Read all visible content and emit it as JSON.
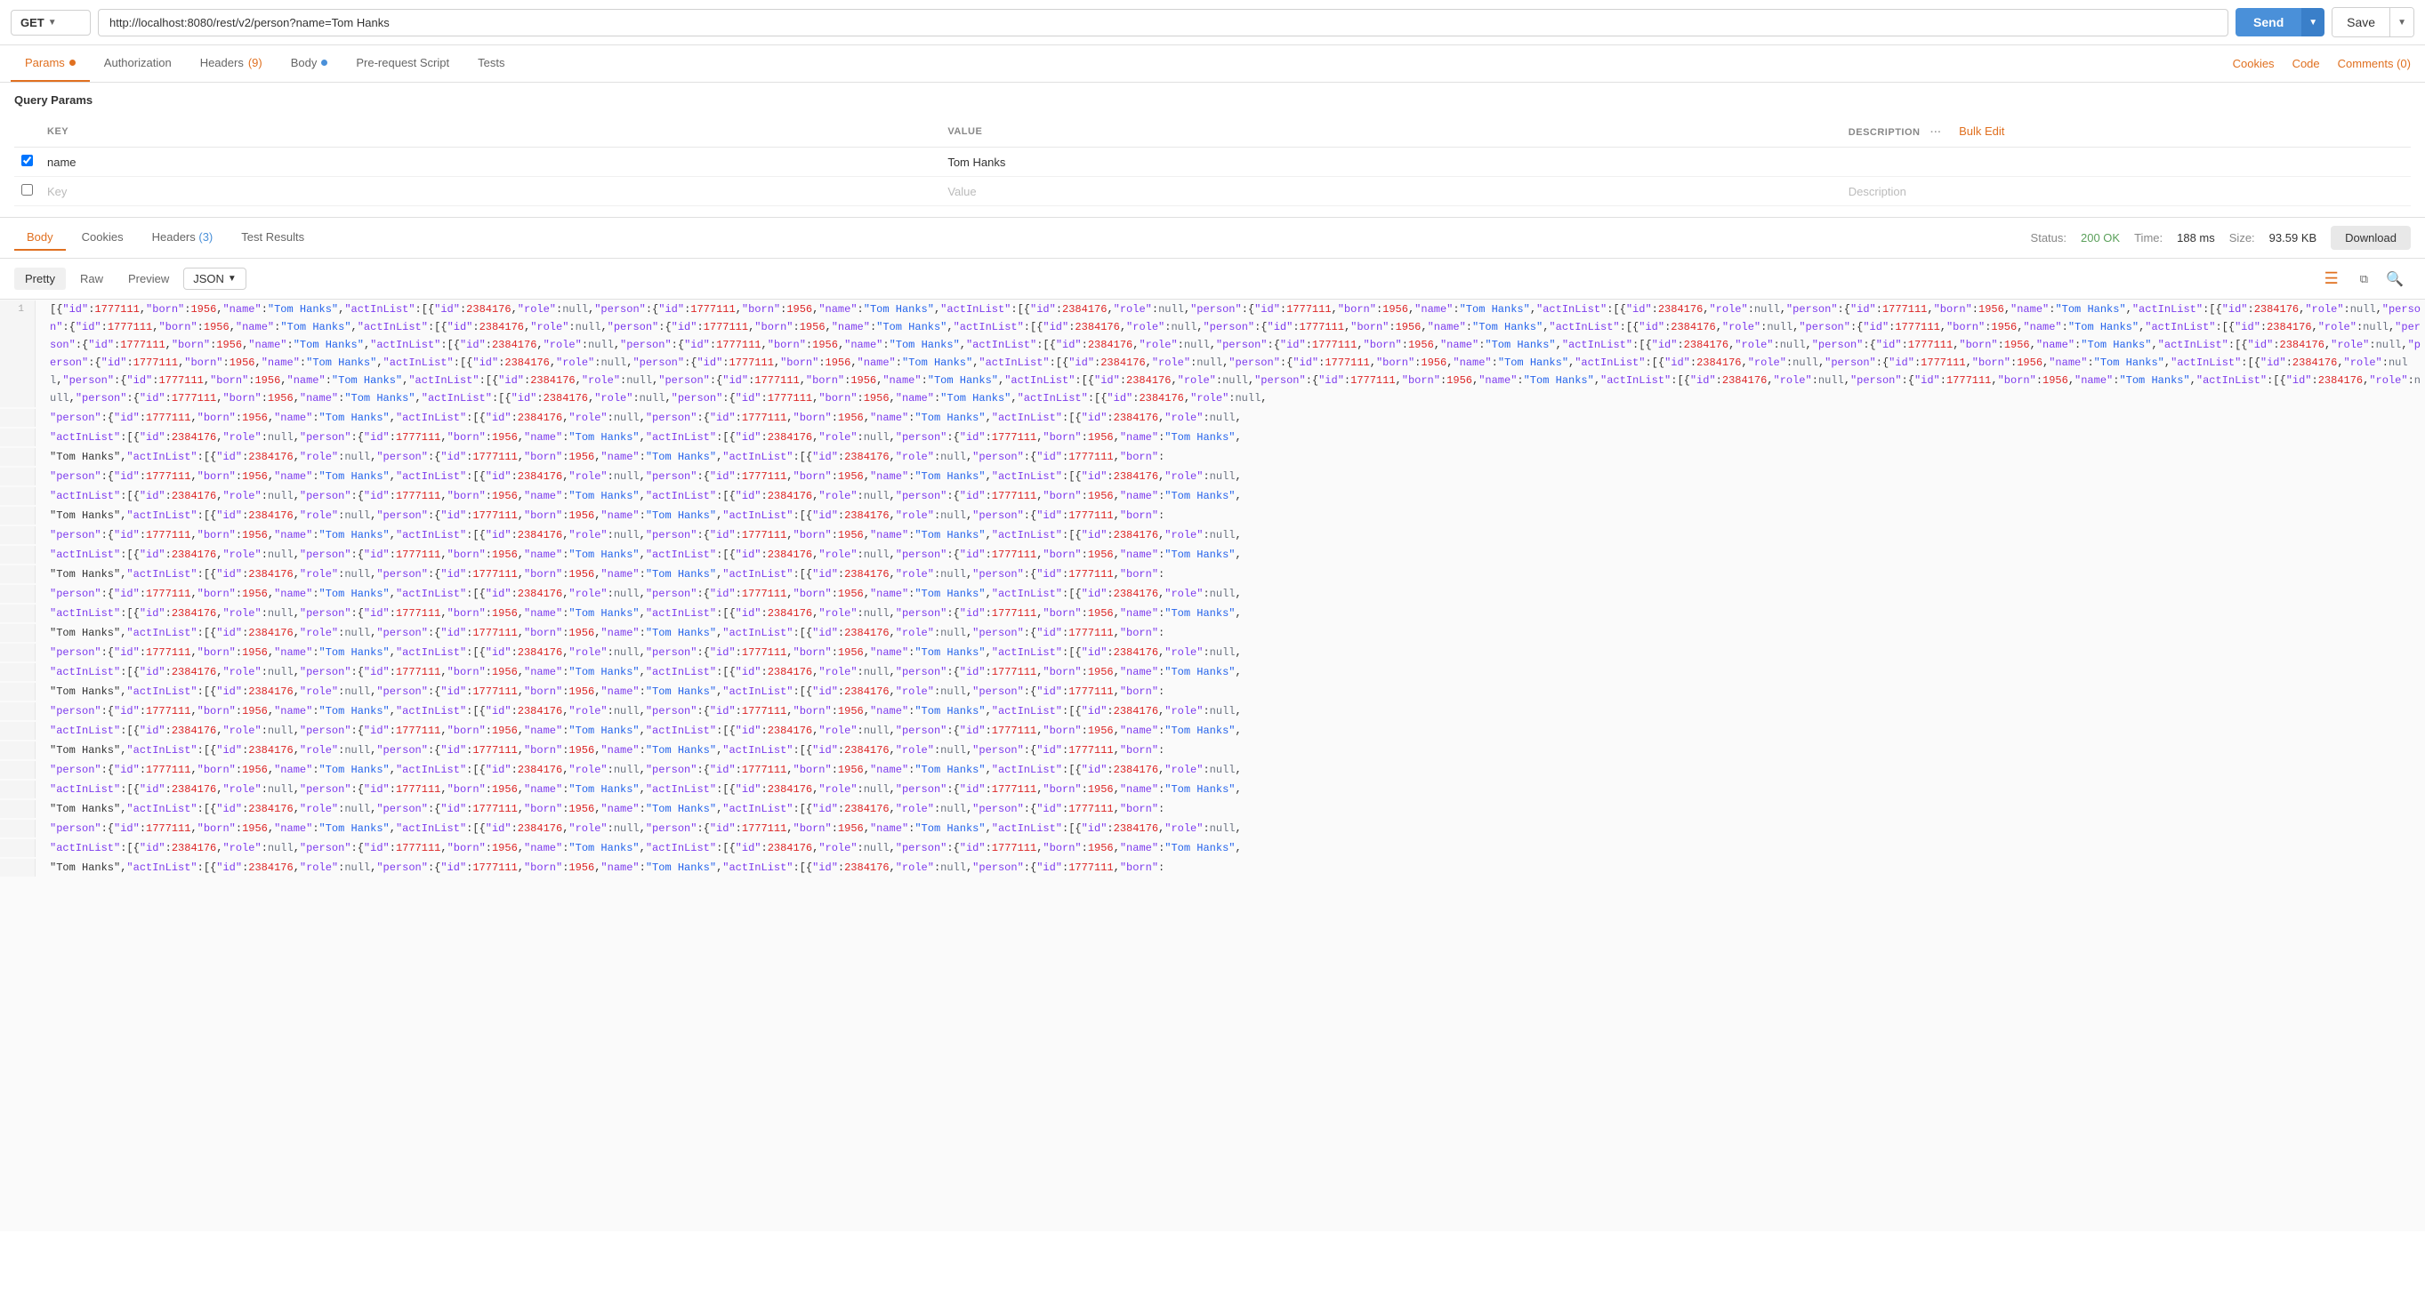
{
  "url_bar": {
    "method": "GET",
    "url": "http://localhost:8080/rest/v2/person?name=Tom Hanks",
    "send_label": "Send",
    "save_label": "Save"
  },
  "request_tabs": {
    "tabs": [
      {
        "id": "params",
        "label": "Params",
        "active": true,
        "dot": "orange"
      },
      {
        "id": "authorization",
        "label": "Authorization",
        "active": false,
        "dot": null
      },
      {
        "id": "headers",
        "label": "Headers",
        "active": false,
        "badge": "(9)",
        "dot": null
      },
      {
        "id": "body",
        "label": "Body",
        "active": false,
        "dot": "blue"
      },
      {
        "id": "pre-request",
        "label": "Pre-request Script",
        "active": false,
        "dot": null
      },
      {
        "id": "tests",
        "label": "Tests",
        "active": false,
        "dot": null
      }
    ],
    "cookies": "Cookies",
    "code": "Code",
    "comments": "Comments (0)"
  },
  "params_section": {
    "title": "Query Params",
    "columns": {
      "key": "KEY",
      "value": "VALUE",
      "description": "DESCRIPTION"
    },
    "rows": [
      {
        "checked": true,
        "key": "name",
        "value": "Tom Hanks",
        "description": ""
      },
      {
        "checked": false,
        "key": "",
        "value": "",
        "description": ""
      }
    ],
    "key_placeholder": "Key",
    "value_placeholder": "Value",
    "description_placeholder": "Description",
    "bulk_edit": "Bulk Edit"
  },
  "response_section": {
    "tabs": [
      {
        "id": "body",
        "label": "Body",
        "active": true
      },
      {
        "id": "cookies",
        "label": "Cookies",
        "active": false
      },
      {
        "id": "headers",
        "label": "Headers",
        "badge": "3",
        "active": false
      },
      {
        "id": "test-results",
        "label": "Test Results",
        "active": false
      }
    ],
    "status_label": "Status:",
    "status_value": "200 OK",
    "time_label": "Time:",
    "time_value": "188 ms",
    "size_label": "Size:",
    "size_value": "93.59 KB",
    "download": "Download"
  },
  "format_bar": {
    "pretty": "Pretty",
    "raw": "Raw",
    "preview": "Preview",
    "format": "JSON",
    "active": "pretty"
  },
  "json_response": {
    "line1": "[{\"id\":1777111,\"born\":1956,\"name\":\"Tom Hanks\",\"actInList\":[{\"id\":2384176,\"role\":null,\"person\":{\"id\":1777111,\"born\":1956,\"name\":\"Tom Hanks\",\"actInList\":[{\"id\":2384176,\"role\":null",
    "raw_content": "[{\"id\":1777111,\"born\":1956,\"name\":\"Tom Hanks\",\"actInList\":[{\"id\":2384176,\"role\":null,\"person\":{\"id\":1777111,\"born\":1956,\"name\":\"Tom Hanks\",\"actInList\":[{\"id\":2384176,\"role\":null,\"person\":{\"id\":1777111,\"born\":1956,\"name\":\"Tom Hanks\",\"actInList\":[{\"id\":2384176,\"role\":null,\"person\":{\"id\":1777111,\"born\":1956,\"name\":\"Tom Hanks\",\"actInList\":[{\"id\":2384176,\"role\":null,\"person\":{\"id\":1777111,\"born\":1956,\"name\":\"Tom Hanks\",\"actInList\":[{\"id\":2384176,\"role\":null,\"person\":{\"id\":1777111,\"born\":1956,\"name\":\"Tom Hanks\",\"actInList\":[{\"id\":2384176,\"role\":null,\"person\":{\"id\":1777111,\"born\":1956,\"name\":\"Tom Hanks\",\"actInList\":[{\"id\":2384176,\"role\":null,\"person\":{\"id\":1777111,\"born\":1956,\"name\":\"Tom Hanks\",\"actInList\":[{\"id\":2384176,\"role\":null,\"person\":{\"id\":1777111,\"born\":1956,\"name\":\"Tom Hanks\",\"actInList\":[{\"id\":2384176,\"role\":null}]}}]}}]}}]}}]}}]}}]}}]}}]}}]}}]"
  }
}
